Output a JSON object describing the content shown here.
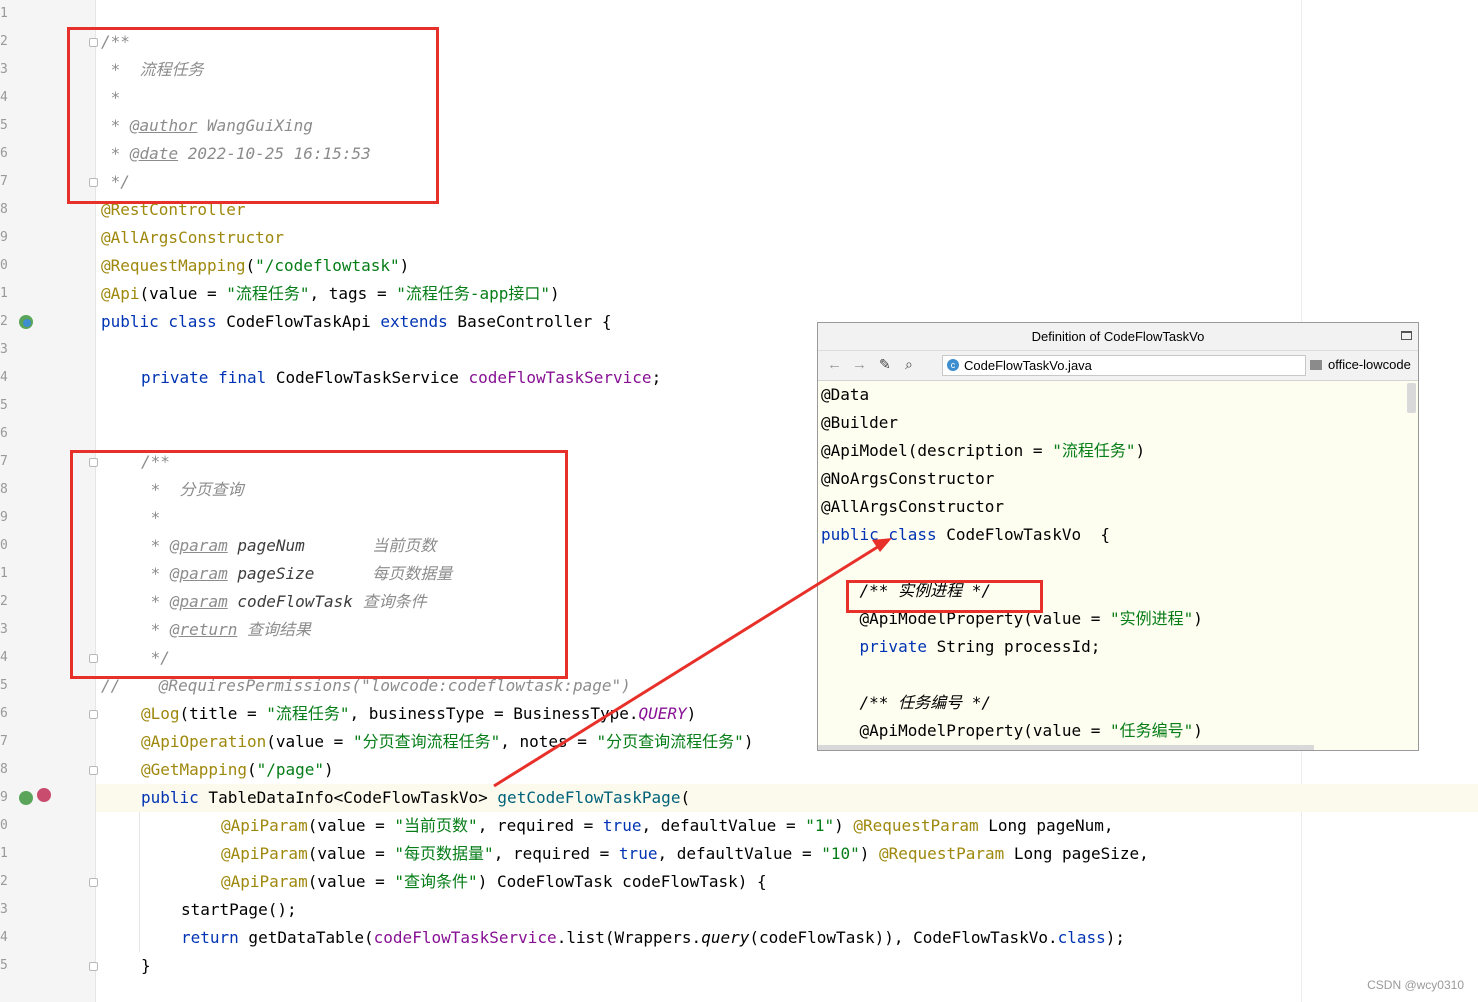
{
  "editor": {
    "line_numbers": [
      "1",
      "2",
      "3",
      "4",
      "5",
      "6",
      "7",
      "8",
      "9",
      "0",
      "1",
      "2",
      "3",
      "4",
      "5",
      "6",
      "7",
      "8",
      "9",
      "0",
      "1",
      "2",
      "3",
      "4",
      "5",
      "6",
      "7",
      "8",
      "9",
      "0",
      "1",
      "2",
      "3",
      "4",
      "5"
    ],
    "code": {
      "c_open": "/**",
      "c_title": " *  流程任务",
      "c_star": " *",
      "c_author_pre": " * ",
      "c_author_tag": "@author",
      "c_author_val": " WangGuiXing",
      "c_date_pre": " * ",
      "c_date_tag": "@date",
      "c_date_val": " 2022-10-25 16:15:53",
      "c_close": " */",
      "a_restcontroller": "@RestController",
      "a_allargs": "@AllArgsConstructor",
      "rm_ann": "@RequestMapping",
      "rm_open": "(",
      "rm_str": "\"/codeflowtask\"",
      "rm_close": ")",
      "api_ann": "@Api",
      "api_a": "(value = ",
      "api_s1": "\"流程任务\"",
      "api_b": ", tags = ",
      "api_s2": "\"流程任务-app接口\"",
      "api_c": ")",
      "cls_kw1": "public class",
      "cls_name": " CodeFlowTaskApi ",
      "cls_kw2": "extends",
      "cls_rest": " BaseController {",
      "fld_kw": "private final",
      "fld_type": " CodeFlowTaskService ",
      "fld_name": "codeFlowTaskService",
      "fld_semi": ";",
      "m_open": "/**",
      "m_title": " *  分页查询",
      "m_star": " *",
      "m_p1_pre": " * ",
      "m_p1_tag": "@param",
      "m_p1_name": " pageNum       ",
      "m_p1_desc": "当前页数",
      "m_p2_pre": " * ",
      "m_p2_tag": "@param",
      "m_p2_name": " pageSize      ",
      "m_p2_desc": "每页数据量",
      "m_p3_pre": " * ",
      "m_p3_tag": "@param",
      "m_p3_name": " codeFlowTask ",
      "m_p3_desc": "查询条件",
      "m_ret_pre": " * ",
      "m_ret_tag": "@return",
      "m_ret_desc": " 查询结果",
      "m_close": " */",
      "rp_line": "//    @RequiresPermissions(\"lowcode:codeflowtask:page\")",
      "log_ann": "@Log",
      "log_a": "(title = ",
      "log_s": "\"流程任务\"",
      "log_b": ", businessType = BusinessType.",
      "log_c": "QUERY",
      "log_d": ")",
      "op_ann": "@ApiOperation",
      "op_a": "(value = ",
      "op_s1": "\"分页查询流程任务\"",
      "op_b": ", notes = ",
      "op_s2": "\"分页查询流程任务\"",
      "op_c": ")",
      "gm_ann": "@GetMapping",
      "gm_a": "(",
      "gm_s": "\"/page\"",
      "gm_b": ")",
      "sig_kw": "public",
      "sig_a": " TableDataInfo<CodeFlowTaskVo> ",
      "sig_m": "getCodeFlowTaskPage",
      "sig_b": "(",
      "p1_ann": "@ApiParam",
      "p1_a": "(value = ",
      "p1_s": "\"当前页数\"",
      "p1_b": ", required = ",
      "p1_kw": "true",
      "p1_c": ", defaultValue = ",
      "p1_s2": "\"1\"",
      "p1_d": ") ",
      "p1_ann2": "@RequestParam",
      "p1_e": " Long pageNum,",
      "p2_ann": "@ApiParam",
      "p2_a": "(value = ",
      "p2_s": "\"每页数据量\"",
      "p2_b": ", required = ",
      "p2_kw": "true",
      "p2_c": ", defaultValue = ",
      "p2_s2": "\"10\"",
      "p2_d": ") ",
      "p2_ann2": "@RequestParam",
      "p2_e": " Long pageSize,",
      "p3_ann": "@ApiParam",
      "p3_a": "(value = ",
      "p3_s": "\"查询条件\"",
      "p3_b": ") CodeFlowTask codeFlowTask) {",
      "sp": "startPage();",
      "ret_kw": "return",
      "ret_a": " getDataTable(",
      "ret_f": "codeFlowTaskService",
      "ret_b": ".list(Wrappers.",
      "ret_q": "query",
      "ret_c": "(codeFlowTask)), CodeFlowTaskVo.",
      "ret_cls": "class",
      "ret_d": ");",
      "end_brace": "}"
    }
  },
  "popup": {
    "title": "Definition of CodeFlowTaskVo",
    "file_name": "CodeFlowTaskVo.java",
    "module_name": "office-lowcode",
    "lines": {
      "l1": "@Data",
      "l2": "@Builder",
      "l3a": "@ApiModel(description = ",
      "l3s": "\"流程任务\"",
      "l3b": ")",
      "l4": "@NoArgsConstructor",
      "l5": "@AllArgsConstructor",
      "l6kw": "public class",
      "l6b": " CodeFlowTaskVo  {",
      "l8": "    /** 实例进程 */",
      "l9a": "    @ApiModelProperty(value = ",
      "l9s": "\"实例进程\"",
      "l9b": ")",
      "l10kw": "    private",
      "l10b": " String processId;",
      "l12": "    /** 任务编号 */",
      "l13a": "    @ApiModelProperty(value = ",
      "l13s": "\"任务编号\"",
      "l13b": ")"
    }
  },
  "watermark": "CSDN @wcy0310",
  "colors": {
    "annotation_box": "#e8302a",
    "keyword": "#0033b3",
    "string": "#067d17",
    "annotation": "#9e880d",
    "comment": "#8c8c8c"
  }
}
